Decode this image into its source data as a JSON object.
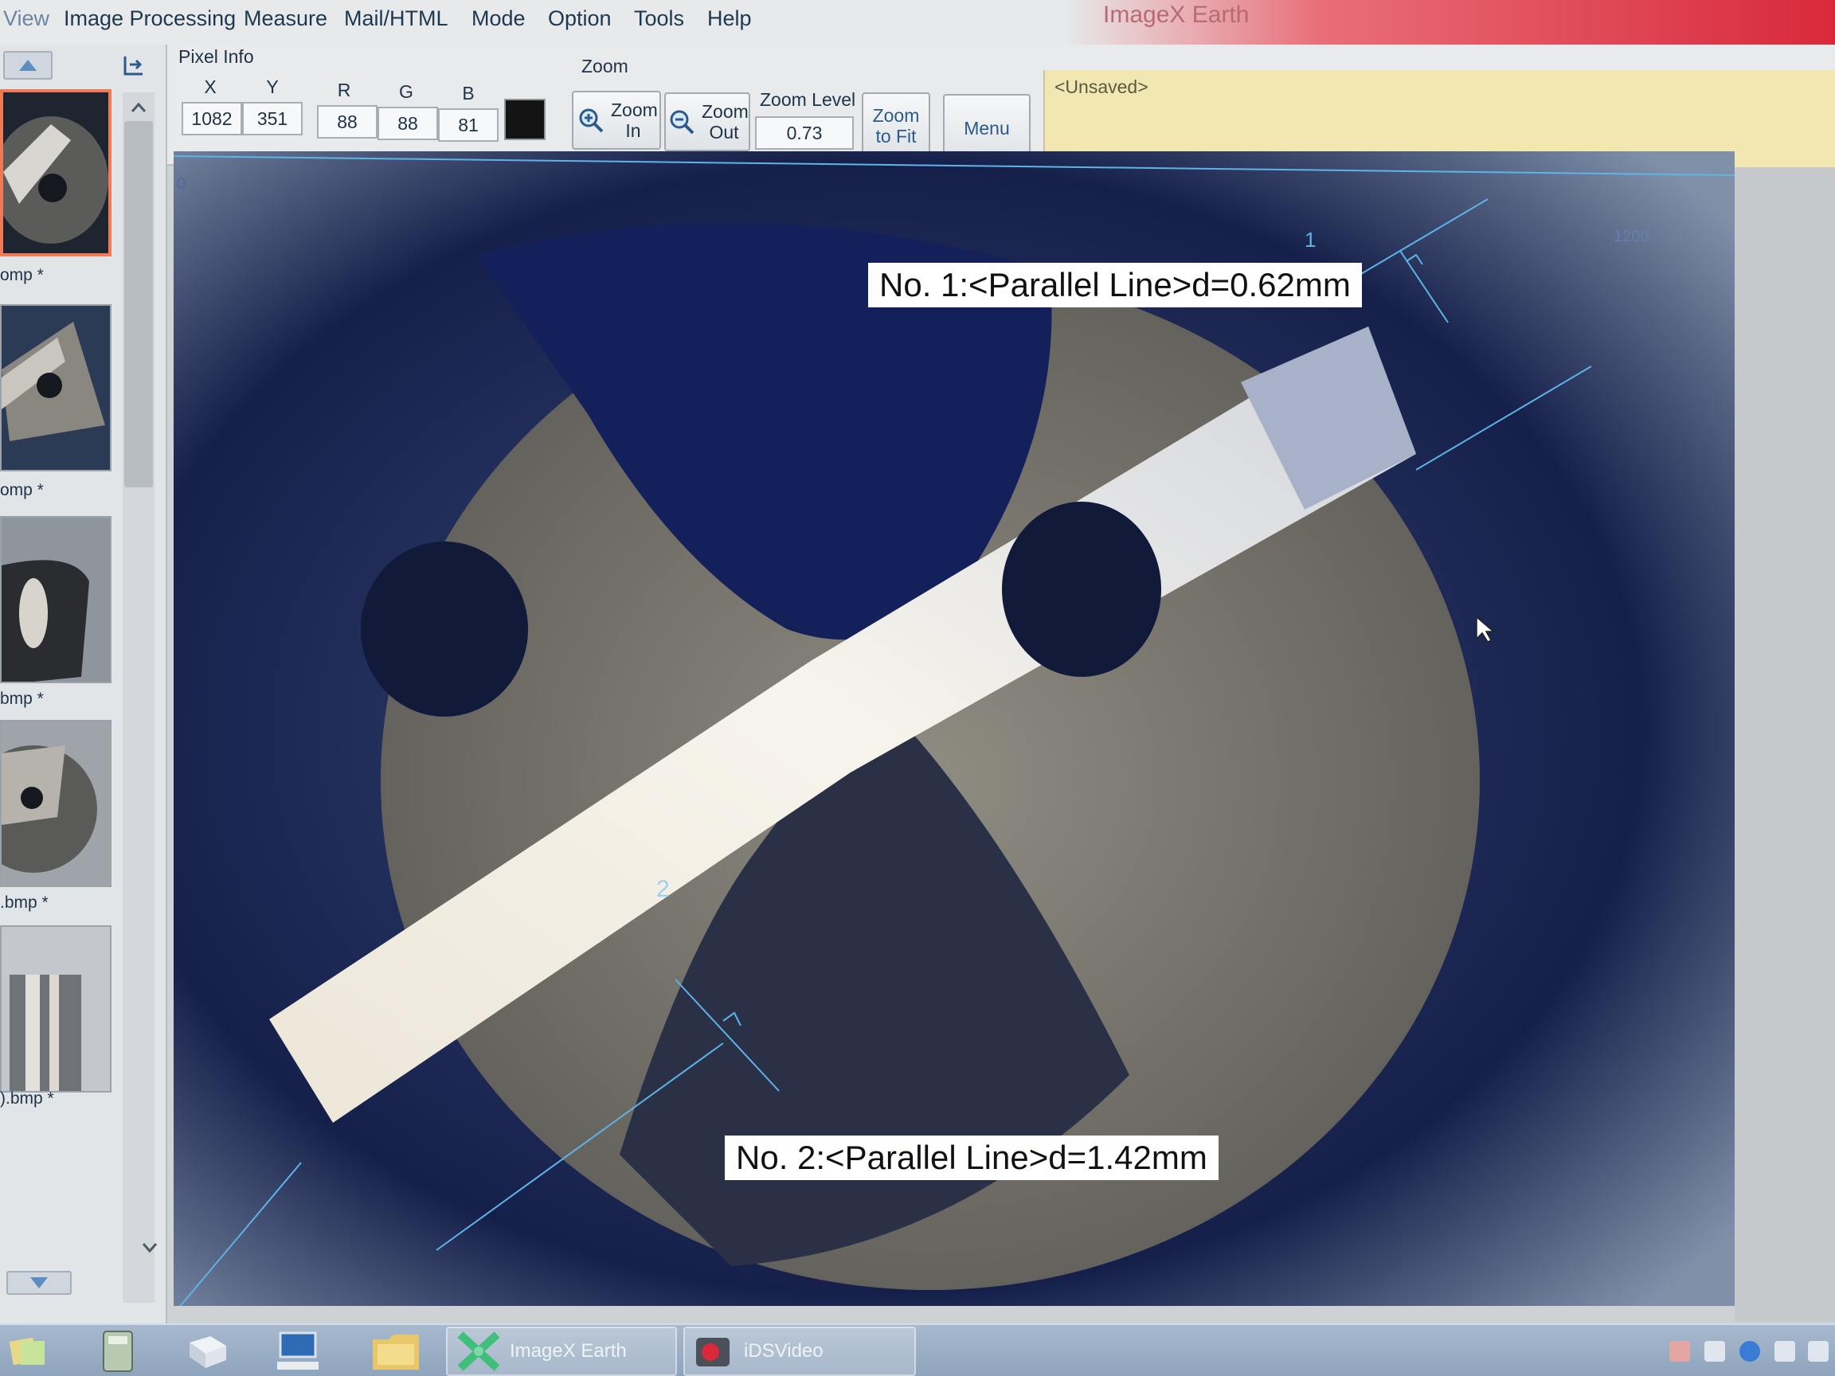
{
  "app": {
    "title": "ImageX Earth"
  },
  "menu": [
    "View",
    "Image Processing",
    "Measure",
    "Mail/HTML",
    "Mode",
    "Option",
    "Tools",
    "Help"
  ],
  "pixel_info": {
    "title": "Pixel Info",
    "labels": {
      "x": "X",
      "y": "Y",
      "r": "R",
      "g": "G",
      "b": "B"
    },
    "values": {
      "x": "1082",
      "y": "351",
      "r": "88",
      "g": "88",
      "b": "81"
    },
    "swatch_color": "#141414"
  },
  "zoom": {
    "title": "Zoom",
    "zoom_in": "Zoom In",
    "zoom_out": "Zoom Out",
    "level_label": "Zoom Level",
    "level_value": "0.73",
    "fit": "Zoom to Fit"
  },
  "menu_button": "Menu",
  "status": "<Unsaved>",
  "thumbnails": [
    {
      "label": "omp *"
    },
    {
      "label": "omp *"
    },
    {
      "label": "bmp *"
    },
    {
      "label": ".bmp *"
    },
    {
      "label": ").bmp *"
    }
  ],
  "ruler": {
    "tick_0": "0",
    "tick_1200": "1200"
  },
  "measurements": [
    {
      "index": "1",
      "text": "No. 1:<Parallel Line>d=0.62mm"
    },
    {
      "index": "2",
      "text": "No. 2:<Parallel Line>d=1.42mm"
    }
  ],
  "taskbar": [
    {
      "label": "ImageX Earth"
    },
    {
      "label": "iDSVideo"
    }
  ],
  "colors": {
    "measure_line": "#5fb3e8",
    "status_bg": "#f3e7b1",
    "selected_border": "#ef7a57"
  }
}
